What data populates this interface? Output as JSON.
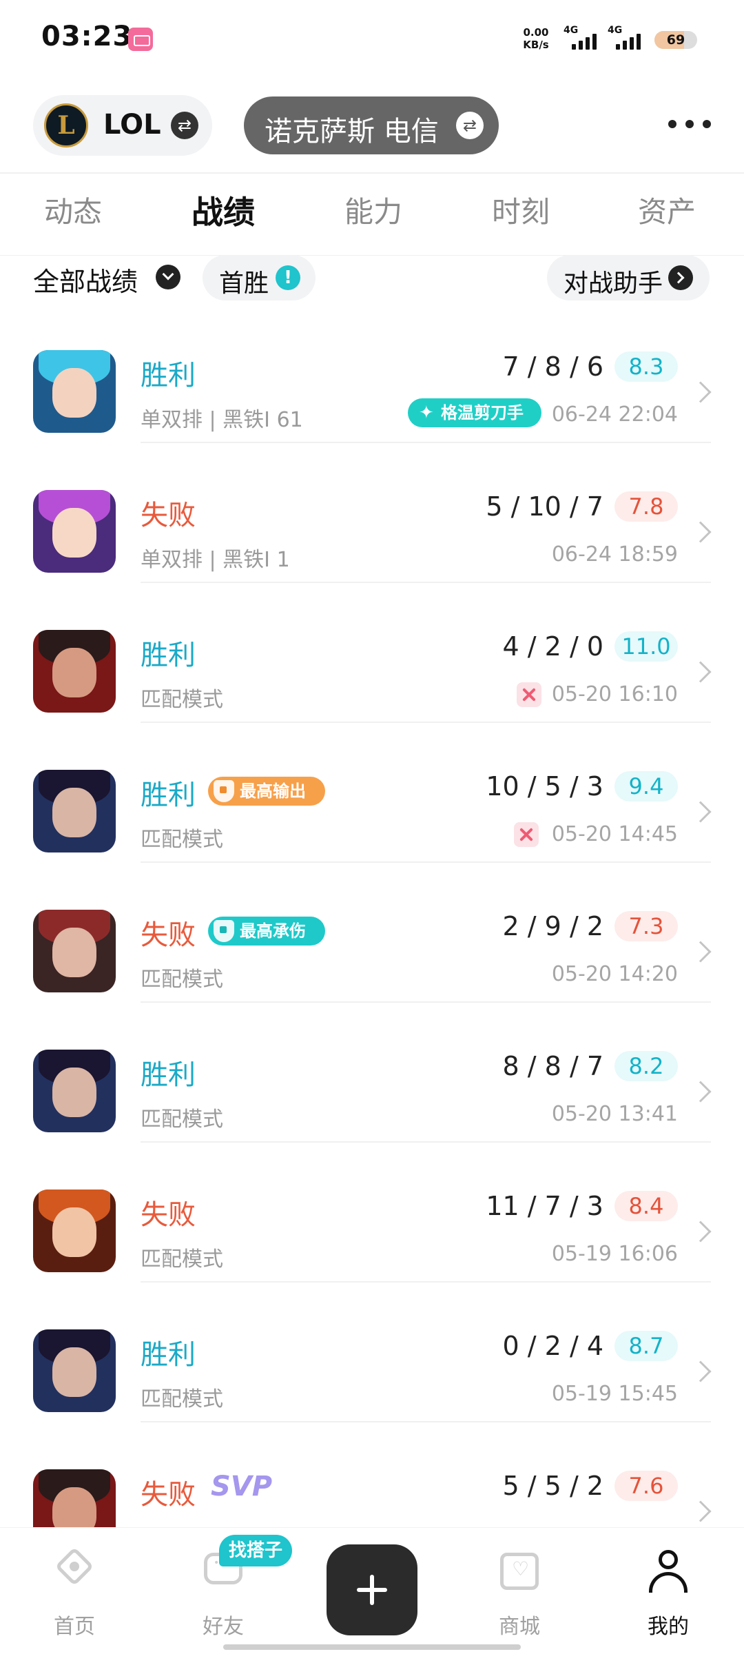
{
  "status_bar": {
    "time": "03:23",
    "net_speed_value": "0.00",
    "net_speed_unit": "KB/s",
    "signal1": "4G",
    "signal2": "4G",
    "battery": "69",
    "battery_level": 0.69
  },
  "header": {
    "game_logo_letter": "L",
    "game_name": "LOL",
    "server": "诺克萨斯 电信"
  },
  "tabs": [
    {
      "label": "动态",
      "active": false
    },
    {
      "label": "战绩",
      "active": true
    },
    {
      "label": "能力",
      "active": false
    },
    {
      "label": "时刻",
      "active": false
    },
    {
      "label": "资产",
      "active": false
    }
  ],
  "filters": {
    "all_label": "全部战绩",
    "first_win_label": "首胜",
    "first_win_info": "!",
    "assistant_label": "对战助手"
  },
  "matches": [
    {
      "result": "胜利",
      "outcome": "win",
      "mode": "单双排 | 黑铁I 61",
      "kda": "7 / 8 / 6",
      "score": "8.3",
      "time": "06-24 22:04",
      "highlight": "格温剪刀手",
      "avatar": {
        "bg": "#1f5a8c",
        "hair": "#3ec4e6",
        "face": "#f3d2c0"
      }
    },
    {
      "result": "失败",
      "outcome": "loss",
      "mode": "单双排 | 黑铁I 1",
      "kda": "5 / 10 / 7",
      "score": "7.8",
      "time": "06-24 18:59",
      "avatar": {
        "bg": "#4a2b7c",
        "hair": "#b64fd6",
        "face": "#f7d8c6"
      }
    },
    {
      "result": "胜利",
      "outcome": "win",
      "mode": "匹配模式",
      "kda": "4 / 2 / 0",
      "score": "11.0",
      "time": "05-20 16:10",
      "clip": true,
      "avatar": {
        "bg": "#7a1717",
        "hair": "#2a1a1a",
        "face": "#d69a82"
      }
    },
    {
      "result": "胜利",
      "outcome": "win",
      "mode": "匹配模式",
      "kda": "10 / 5 / 3",
      "score": "9.4",
      "time": "05-20 14:45",
      "clip": true,
      "tag": "最高输出",
      "tag_type": "damage",
      "avatar": {
        "bg": "#22305e",
        "hair": "#1a1530",
        "face": "#d9b5a6"
      }
    },
    {
      "result": "失败",
      "outcome": "loss",
      "mode": "匹配模式",
      "kda": "2 / 9 / 2",
      "score": "7.3",
      "time": "05-20 14:20",
      "tag": "最高承伤",
      "tag_type": "tank",
      "avatar": {
        "bg": "#3a2424",
        "hair": "#8c2a2a",
        "face": "#e0b6a4"
      }
    },
    {
      "result": "胜利",
      "outcome": "win",
      "mode": "匹配模式",
      "kda": "8 / 8 / 7",
      "score": "8.2",
      "time": "05-20 13:41",
      "avatar": {
        "bg": "#22305e",
        "hair": "#1a1530",
        "face": "#d9b5a6"
      }
    },
    {
      "result": "失败",
      "outcome": "loss",
      "mode": "匹配模式",
      "kda": "11 / 7 / 3",
      "score": "8.4",
      "time": "05-19 16:06",
      "avatar": {
        "bg": "#5a1e10",
        "hair": "#d2581f",
        "face": "#f1c4a6"
      }
    },
    {
      "result": "胜利",
      "outcome": "win",
      "mode": "匹配模式",
      "kda": "0 / 2 / 4",
      "score": "8.7",
      "time": "05-19 15:45",
      "avatar": {
        "bg": "#22305e",
        "hair": "#1a1530",
        "face": "#d9b5a6"
      }
    },
    {
      "result": "失败",
      "outcome": "loss",
      "mode": "",
      "kda": "5 / 5 / 2",
      "score": "7.6",
      "time": "",
      "svp": "SVP",
      "avatar": {
        "bg": "#7a1717",
        "hair": "#2a1a1a",
        "face": "#d69a82"
      }
    }
  ],
  "bottom_nav": {
    "home": "首页",
    "friends": "好友",
    "find_partner": "找搭子",
    "shop": "商城",
    "me": "我的"
  },
  "colors": {
    "win": "#1ba9c7",
    "loss": "#e85a3c",
    "accent": "#1fc4cc"
  }
}
